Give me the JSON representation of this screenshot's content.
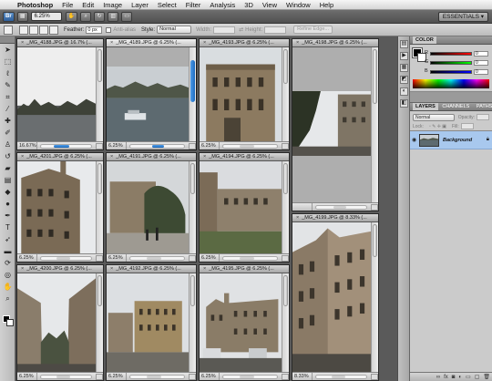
{
  "menubar": {
    "apple": "",
    "items": [
      {
        "label": "Photoshop"
      },
      {
        "label": "File"
      },
      {
        "label": "Edit"
      },
      {
        "label": "Image"
      },
      {
        "label": "Layer"
      },
      {
        "label": "Select"
      },
      {
        "label": "Filter"
      },
      {
        "label": "Analysis"
      },
      {
        "label": "3D"
      },
      {
        "label": "View"
      },
      {
        "label": "Window"
      },
      {
        "label": "Help"
      }
    ]
  },
  "appbar": {
    "br_label": "Br",
    "zoom_value": "6.25%",
    "workspace": "ESSENTIALS ▾"
  },
  "options": {
    "feather_label": "Feather:",
    "feather_value": "0 px",
    "antialias_label": "Anti-alias",
    "style_label": "Style:",
    "style_value": "Normal",
    "width_label": "Width:",
    "height_label": "Height:",
    "refine_label": "Refine Edge..."
  },
  "documents": [
    {
      "title": "_MG_4188.JPG @ 16.7% (...",
      "zoom": "16.67%"
    },
    {
      "title": "_MG_4189.JPG @ 6.25% (...",
      "zoom": "6.25%"
    },
    {
      "title": "_MG_4193.JPG @ 6.25% (...",
      "zoom": "6.25%"
    },
    {
      "title": "_MG_4198.JPG @ 6.25% (...",
      "zoom": ""
    },
    {
      "title": "_MG_4201.JPG @ 6.25% (...",
      "zoom": "6.25%"
    },
    {
      "title": "_MG_4191.JPG @ 6.25% (...",
      "zoom": "6.25%"
    },
    {
      "title": "_MG_4194.JPG @ 6.25% (...",
      "zoom": "6.25%"
    },
    {
      "title": "_MG_4199.JPG @ 8.33% (...",
      "zoom": "8.33%"
    },
    {
      "title": "_MG_4200.JPG @ 6.25% (...",
      "zoom": "6.25%"
    },
    {
      "title": "_MG_4192.JPG @ 6.25% (...",
      "zoom": "6.25%"
    },
    {
      "title": "_MG_4195.JPG @ 6.25% (...",
      "zoom": "6.25%"
    }
  ],
  "panels": {
    "color_tab": "COLOR",
    "color_channels": [
      "R",
      "G",
      "B"
    ],
    "color_values": [
      "0",
      "0",
      "0"
    ],
    "tabs": [
      "LAYERS",
      "CHANNELS",
      "PATHS"
    ],
    "blend_mode": "Normal",
    "opacity_label": "Opacity:",
    "lock_label": "Lock:",
    "fill_label": "Fill:",
    "layer_name": "Background"
  },
  "colors": {
    "selection_blue": "#a8c8ee",
    "scroll_blue": "#1c6bc0"
  }
}
